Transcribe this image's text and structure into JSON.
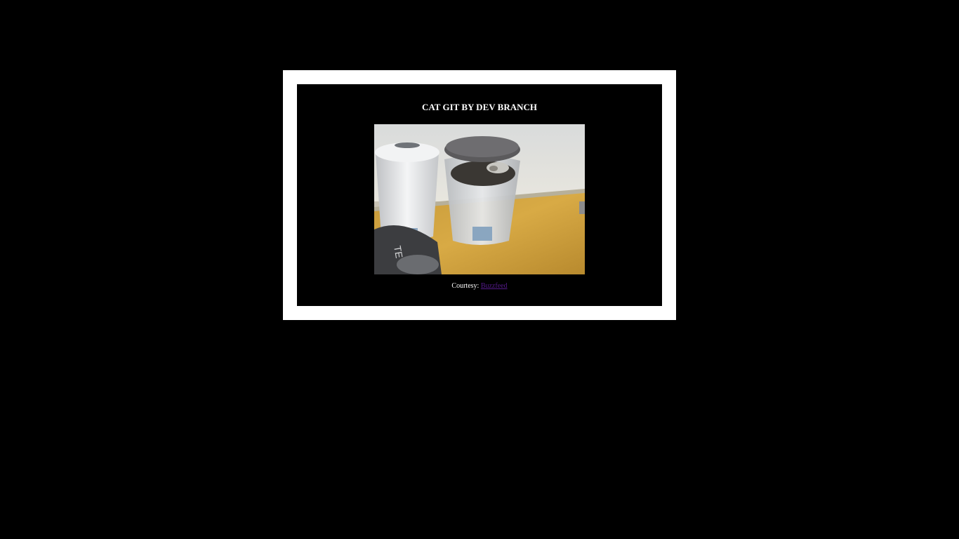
{
  "header": {
    "title": "CAT GIT BY DEV BRANCH"
  },
  "image": {
    "subject": "cat-in-trash-can-gif"
  },
  "caption": {
    "prefix": "Courtesy:",
    "link_text": "Buzzfeed"
  },
  "colors": {
    "page_background": "#000000",
    "frame": "#ffffff",
    "visited_link": "#551a8b"
  }
}
